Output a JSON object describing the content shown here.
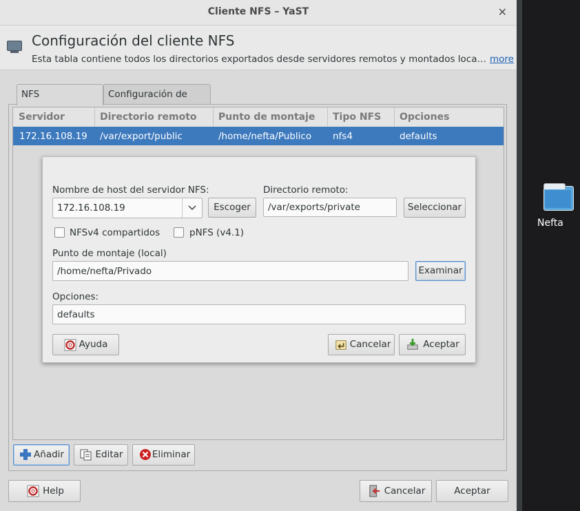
{
  "window": {
    "title": "Cliente NFS – YaST",
    "close_glyph": "✕"
  },
  "header": {
    "icon": "network-computer-icon",
    "title": "Configuración del cliente NFS",
    "description": "Esta tabla contiene todos los directorios exportados desde servidores remotos y montados localm...",
    "more_link": "more"
  },
  "tabs": [
    {
      "label": "NFS compartidos",
      "active": true
    },
    {
      "label": "Configuración de NFS",
      "active": false
    }
  ],
  "table": {
    "columns": [
      "Servidor",
      "Directorio remoto",
      "Punto de montaje",
      "Tipo NFS",
      "Opciones"
    ],
    "rows": [
      {
        "server": "172.16.108.19",
        "remote_dir": "/var/export/public",
        "mount_point": "/home/nefta/Publico",
        "nfs_type": "nfs4",
        "options": "defaults",
        "selected": true
      }
    ]
  },
  "dialog": {
    "server_label": "Nombre de host del servidor NFS:",
    "server_value": "172.16.108.19",
    "choose_button": "Escoger",
    "remote_dir_label": "Directorio remoto:",
    "remote_dir_value": "/var/exports/private",
    "select_button": "Seleccionar",
    "nfsv4_label": "NFSv4 compartidos",
    "nfsv4_checked": false,
    "pnfs_label": "pNFS (v4.1)",
    "pnfs_checked": false,
    "mount_label": "Punto de montaje (local)",
    "mount_value": "/home/nefta/Privado",
    "browse_button": "Examinar",
    "options_label": "Opciones:",
    "options_value": "defaults",
    "help_button": "Ayuda",
    "cancel_button": "Cancelar",
    "accept_button": "Aceptar"
  },
  "toolbar": {
    "add": "Añadir",
    "edit": "Editar",
    "delete": "Eliminar"
  },
  "footer": {
    "help": "Help",
    "cancel": "Cancelar",
    "accept": "Aceptar"
  },
  "desktop": {
    "folder_label": "Nefta"
  },
  "colors": {
    "selection": "#3d79bd",
    "link": "#1a5fb4",
    "window_bg": "#dadada",
    "desktop_bg": "#1b1b1d"
  }
}
